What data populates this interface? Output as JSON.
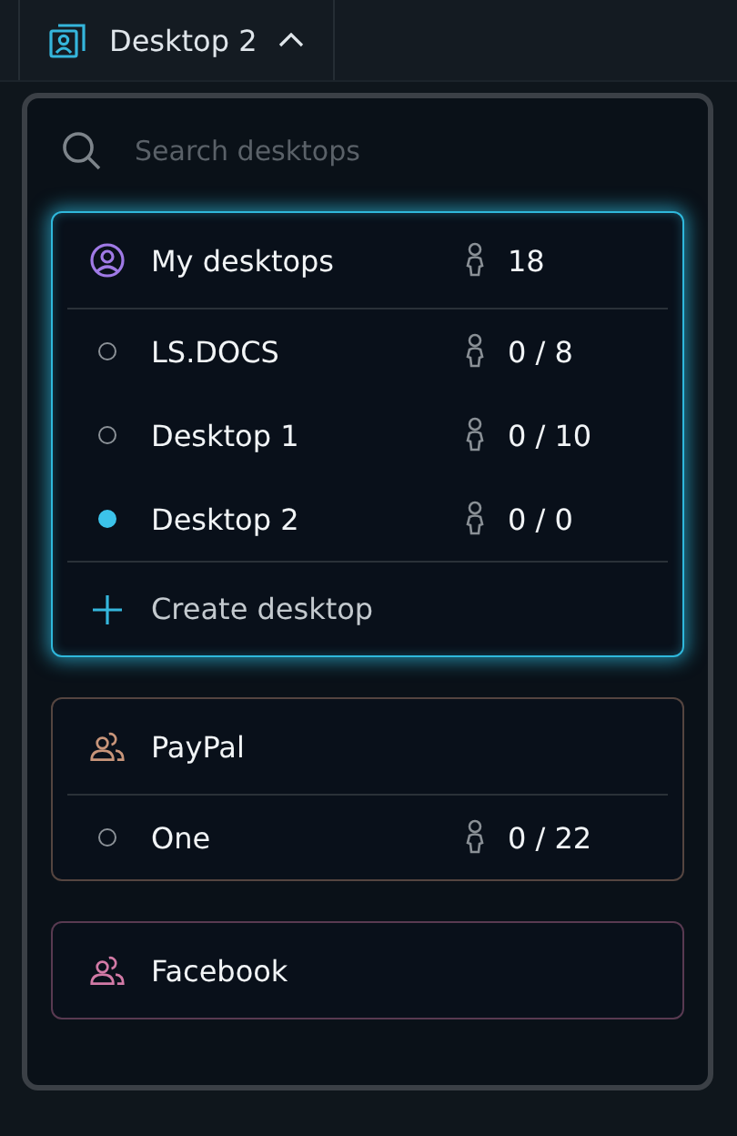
{
  "switcher": {
    "label": "Desktop 2",
    "expanded": true
  },
  "search": {
    "placeholder": "Search desktops"
  },
  "groups": [
    {
      "name": "My desktops",
      "kind": "personal",
      "color": "#a07ae6",
      "active": true,
      "count": "18",
      "items": [
        {
          "name": "LS.DOCS",
          "count": "0 / 8",
          "selected": false
        },
        {
          "name": "Desktop 1",
          "count": "0 / 10",
          "selected": false
        },
        {
          "name": "Desktop 2",
          "count": "0 / 0",
          "selected": true
        }
      ],
      "action": "Create desktop"
    },
    {
      "name": "PayPal",
      "kind": "team",
      "color": "#c8957a",
      "active": false,
      "items": [
        {
          "name": "One",
          "count": "0 / 22",
          "selected": false
        }
      ]
    },
    {
      "name": "Facebook",
      "kind": "team",
      "color": "#d27aa6",
      "active": false
    }
  ]
}
